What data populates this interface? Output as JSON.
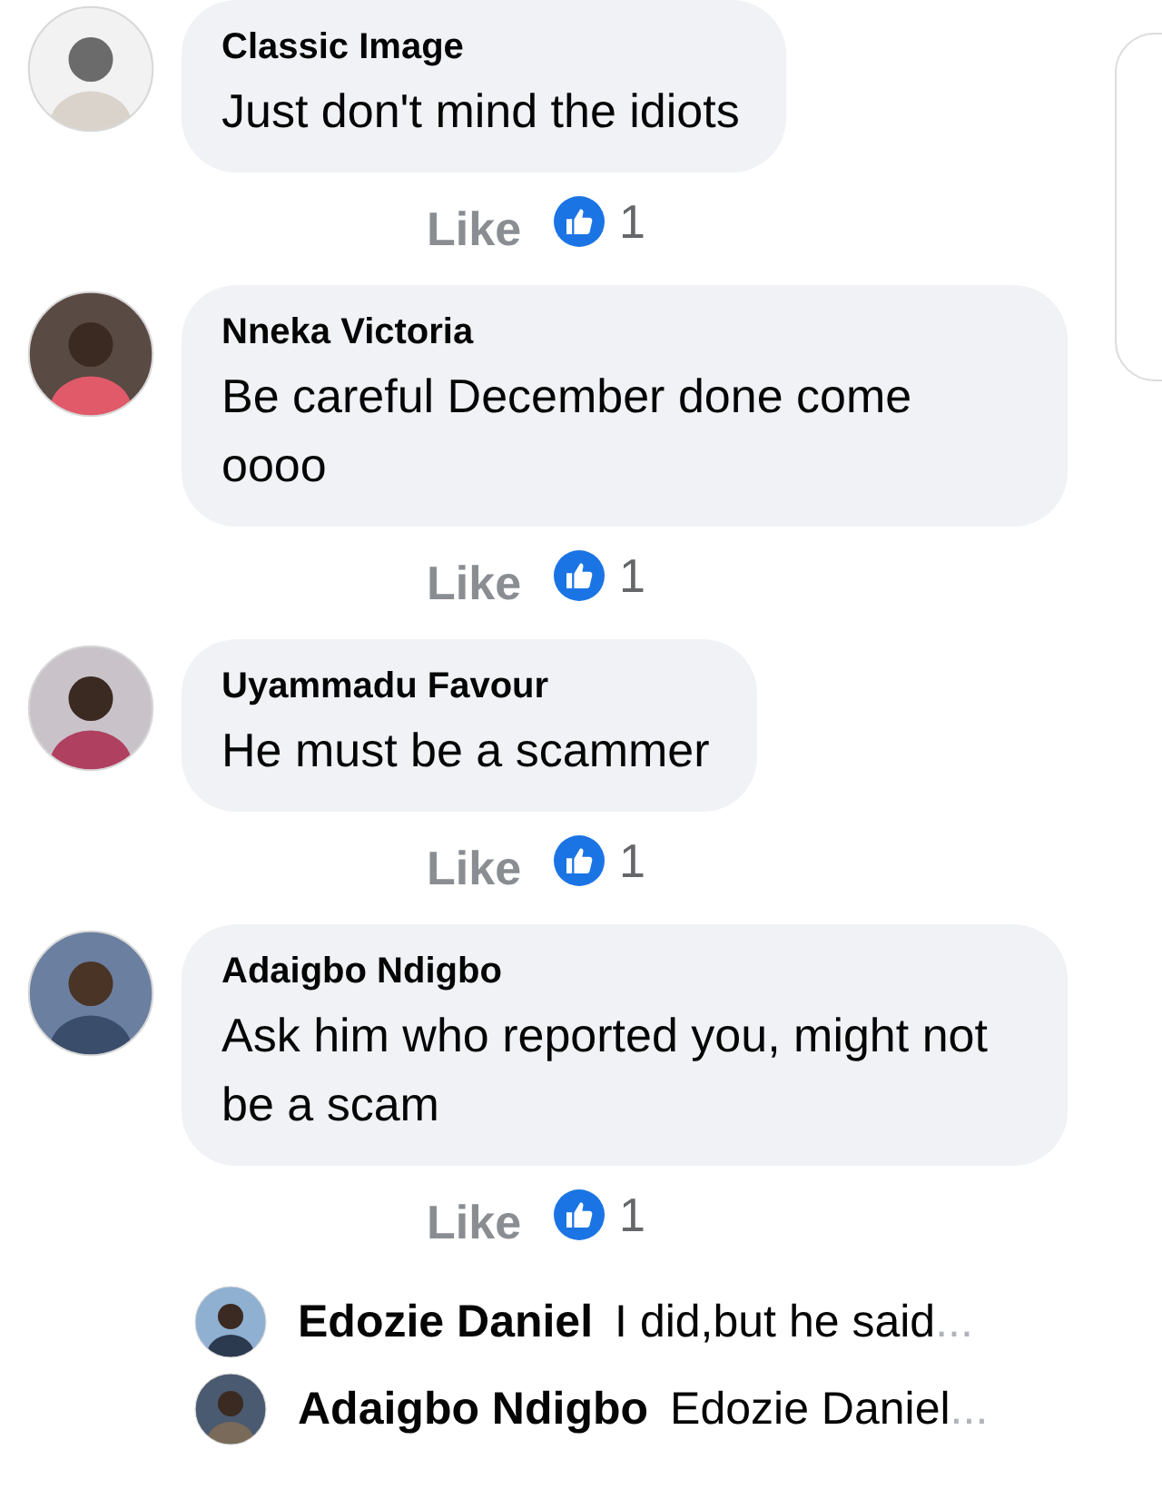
{
  "comments": [
    {
      "author": "Classic Image",
      "text": "Just don't mind the idiots",
      "like_label": "Like",
      "liked": false,
      "reaction_count": "1"
    },
    {
      "author": "Nneka Victoria",
      "text": "Be careful December done come oooo",
      "like_label": "Like",
      "liked": false,
      "reaction_count": "1"
    },
    {
      "author": "Uyammadu Favour",
      "text": "He must be a scammer",
      "like_label": "Like",
      "liked": false,
      "reaction_count": "1"
    },
    {
      "author": "Adaigbo Ndigbo",
      "text": "Ask him who reported you, might not be a scam",
      "like_label": "Like",
      "liked": false,
      "reaction_count": "1",
      "replies": [
        {
          "author": "Edozie Daniel",
          "text": "I did,but he said",
          "more": "..."
        },
        {
          "author": "Adaigbo Ndigbo",
          "text": "Edozie Daniel",
          "more": "..."
        }
      ]
    }
  ]
}
